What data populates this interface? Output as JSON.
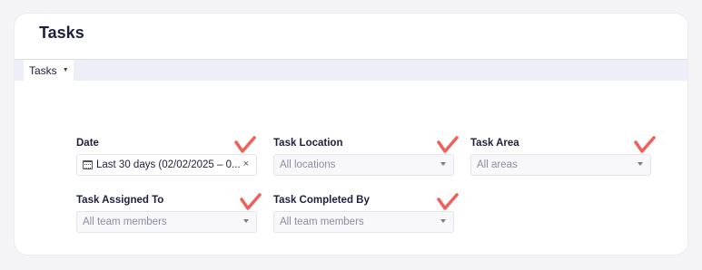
{
  "page": {
    "title": "Tasks"
  },
  "tabs": [
    {
      "label": "Tasks"
    }
  ],
  "filters": {
    "date": {
      "label": "Date",
      "value": "Last 30 days (02/02/2025 – 0..."
    },
    "task_location": {
      "label": "Task Location",
      "placeholder": "All locations"
    },
    "task_area": {
      "label": "Task Area",
      "placeholder": "All areas"
    },
    "task_assigned_to": {
      "label": "Task Assigned To",
      "placeholder": "All team members"
    },
    "task_completed_by": {
      "label": "Task Completed By",
      "placeholder": "All team members"
    }
  },
  "colors": {
    "annotation_check": "#f0605a",
    "title_text": "#1e1f3b",
    "tabbar_bg": "#edeef8"
  },
  "icons": [
    "calendar-icon",
    "clear-icon",
    "chevron-down-icon",
    "checkmark-annotation"
  ]
}
